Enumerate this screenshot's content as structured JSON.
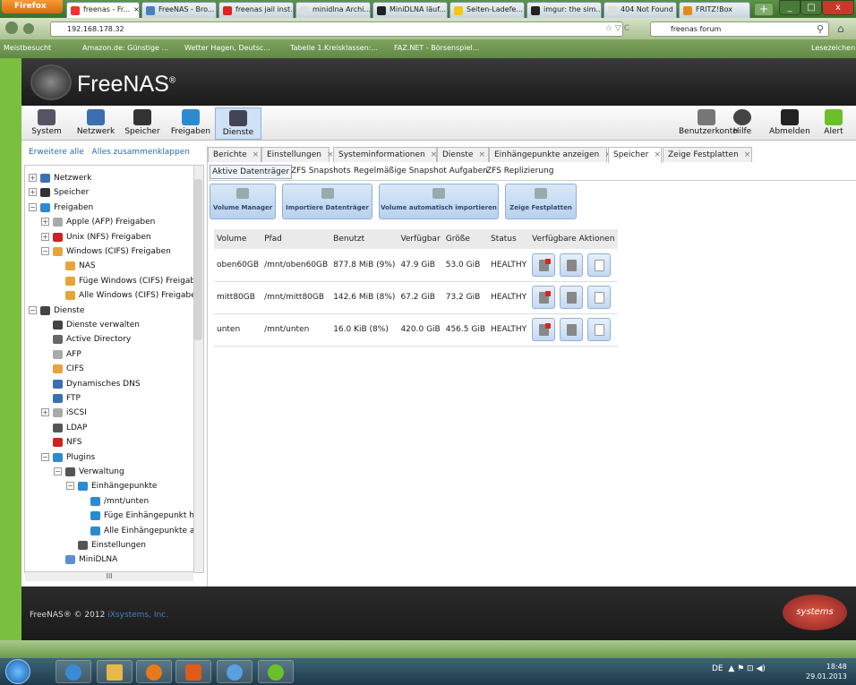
{
  "browser": {
    "app_button": "Firefox",
    "tabs": [
      {
        "label": "freenas - Fr...",
        "close": "×",
        "icon_color": "#e33"
      },
      {
        "label": "FreeNAS - Bro...",
        "icon_color": "#4a7fc0"
      },
      {
        "label": "freenas jail inst...",
        "icon_color": "#d22"
      },
      {
        "label": "minidlna Archi...",
        "icon_color": "#ddd"
      },
      {
        "label": "MiniDLNA läuf...",
        "icon_color": "#222"
      },
      {
        "label": "Seiten-Ladefe...",
        "icon_color": "#f5c518"
      },
      {
        "label": "imgur: the sim...",
        "icon_color": "#222"
      },
      {
        "label": "404 Not Found",
        "icon_color": "#ddd"
      },
      {
        "label": "FRITZ!Box",
        "icon_color": "#e48a1c"
      }
    ],
    "new_tab": "+",
    "url": "192.168.178.32",
    "search_value": "freenas forum",
    "bookmarks": [
      "Meistbesucht",
      "Amazon.de: Günstige ...",
      "Wetter Hagen, Deutsc...",
      "Tabelle 1.Kreisklassen:...",
      "FAZ.NET - Börsenspiel..."
    ],
    "lesezeichen": "Lesezeichen"
  },
  "toolbar": {
    "left": [
      {
        "label": "System",
        "icon": "system-icon"
      },
      {
        "label": "Netzwerk",
        "icon": "network-icon"
      },
      {
        "label": "Speicher",
        "icon": "storage-icon"
      },
      {
        "label": "Freigaben",
        "icon": "sharing-icon"
      },
      {
        "label": "Dienste",
        "icon": "services-icon",
        "active": true
      }
    ],
    "right": [
      {
        "label": "Benutzerkonto",
        "icon": "account-icon"
      },
      {
        "label": "Hilfe",
        "icon": "help-icon"
      },
      {
        "label": "Abmelden",
        "icon": "logout-icon"
      },
      {
        "label": "Alert",
        "icon": "alert-icon"
      }
    ]
  },
  "header": {
    "logo_text": "FreeNAS",
    "logo_mark": "®"
  },
  "tree": {
    "expand_all": "Erweitere alle",
    "collapse_all": "Alles zusammenklappen",
    "nodes": [
      {
        "label": "Netzwerk",
        "exp": "+",
        "icon_color": "#3a6fb0"
      },
      {
        "label": "Speicher",
        "exp": "+",
        "icon_color": "#333"
      },
      {
        "label": "Freigaben",
        "exp": "−",
        "icon_color": "#2c8ad0"
      },
      {
        "label": "Apple (AFP) Freigaben",
        "exp": "+",
        "icon_color": "#aaa"
      },
      {
        "label": "Unix (NFS) Freigaben",
        "exp": "+",
        "icon_color": "#c22"
      },
      {
        "label": "Windows (CIFS) Freigaben",
        "exp": "−",
        "icon_color": "#e8a33a"
      },
      {
        "label": "NAS",
        "icon_color": "#e8a33a"
      },
      {
        "label": "Füge Windows (CIFS) Freigab",
        "icon_color": "#e8a33a"
      },
      {
        "label": "Alle Windows (CIFS) Freigabe",
        "icon_color": "#e8a33a"
      },
      {
        "label": "Dienste",
        "exp": "−",
        "icon_color": "#444"
      },
      {
        "label": "Dienste verwalten",
        "icon_color": "#444"
      },
      {
        "label": "Active Directory",
        "icon_color": "#666"
      },
      {
        "label": "AFP",
        "icon_color": "#aaa"
      },
      {
        "label": "CIFS",
        "icon_color": "#e8a33a"
      },
      {
        "label": "Dynamisches DNS",
        "icon_color": "#3a6fb0"
      },
      {
        "label": "FTP",
        "icon_color": "#3a6fb0"
      },
      {
        "label": "iSCSI",
        "exp": "+",
        "icon_color": "#aaa"
      },
      {
        "label": "LDAP",
        "icon_color": "#555"
      },
      {
        "label": "NFS",
        "icon_color": "#c22"
      },
      {
        "label": "Plugins",
        "exp": "−",
        "icon_color": "#2c8ad0"
      },
      {
        "label": "Verwaltung",
        "exp": "−",
        "icon_color": "#555"
      },
      {
        "label": "Einhängepunkte",
        "exp": "−",
        "icon_color": "#2c8ad0"
      },
      {
        "label": "/mnt/unten",
        "icon_color": "#2c8ad0"
      },
      {
        "label": "Füge Einhängepunkt hir",
        "icon_color": "#2c8ad0"
      },
      {
        "label": "Alle Einhängepunkte ar",
        "icon_color": "#2c8ad0"
      },
      {
        "label": "Einstellungen",
        "icon_color": "#555"
      },
      {
        "label": "MiniDLNA",
        "icon_color": "#5a8fd0"
      }
    ],
    "hscroll_thumb": "III"
  },
  "content_tabs": [
    {
      "label": "Berichte"
    },
    {
      "label": "Einstellungen"
    },
    {
      "label": "Systeminformationen"
    },
    {
      "label": "Dienste"
    },
    {
      "label": "Einhängepunkte anzeigen"
    },
    {
      "label": "Speicher",
      "active": true
    },
    {
      "label": "Zeige Festplatten"
    }
  ],
  "close_glyph": "×",
  "sub_tabs": [
    {
      "label": "Aktive Datenträger",
      "active": true
    },
    {
      "label": "ZFS Snapshots"
    },
    {
      "label": "Regelmäßige Snapshot Aufgaben"
    },
    {
      "label": "ZFS Replizierung"
    }
  ],
  "action_buttons": [
    "Volume Manager",
    "Importiere Datenträger",
    "Volume automatisch importieren",
    "Zeige Festplatten"
  ],
  "table": {
    "headers": [
      "Volume",
      "Pfad",
      "Benutzt",
      "Verfügbar",
      "Größe",
      "Status",
      "Verfügbare Aktionen"
    ],
    "rows": [
      [
        "oben60GB",
        "/mnt/oben60GB",
        "877.8 MiB (9%)",
        "47.9 GiB",
        "53.0 GiB",
        "HEALTHY"
      ],
      [
        "mitt80GB",
        "/mnt/mitt80GB",
        "142.6 MiB (8%)",
        "67.2 GiB",
        "73.2 GiB",
        "HEALTHY"
      ],
      [
        "unten",
        "/mnt/unten",
        "16.0 KiB (8%)",
        "420.0 GiB",
        "456.5 GiB",
        "HEALTHY"
      ]
    ]
  },
  "footer": {
    "copyright": "FreeNAS® © 2012",
    "company": "iXsystems, Inc.",
    "logo_text": "systems"
  },
  "taskbar": {
    "lang": "DE",
    "time": "18:48",
    "date": "29.01.2013"
  },
  "colors": {
    "accent": "#2a6bb5",
    "header_bg": "#222222",
    "sidebar_green": "#7bbf3e"
  }
}
